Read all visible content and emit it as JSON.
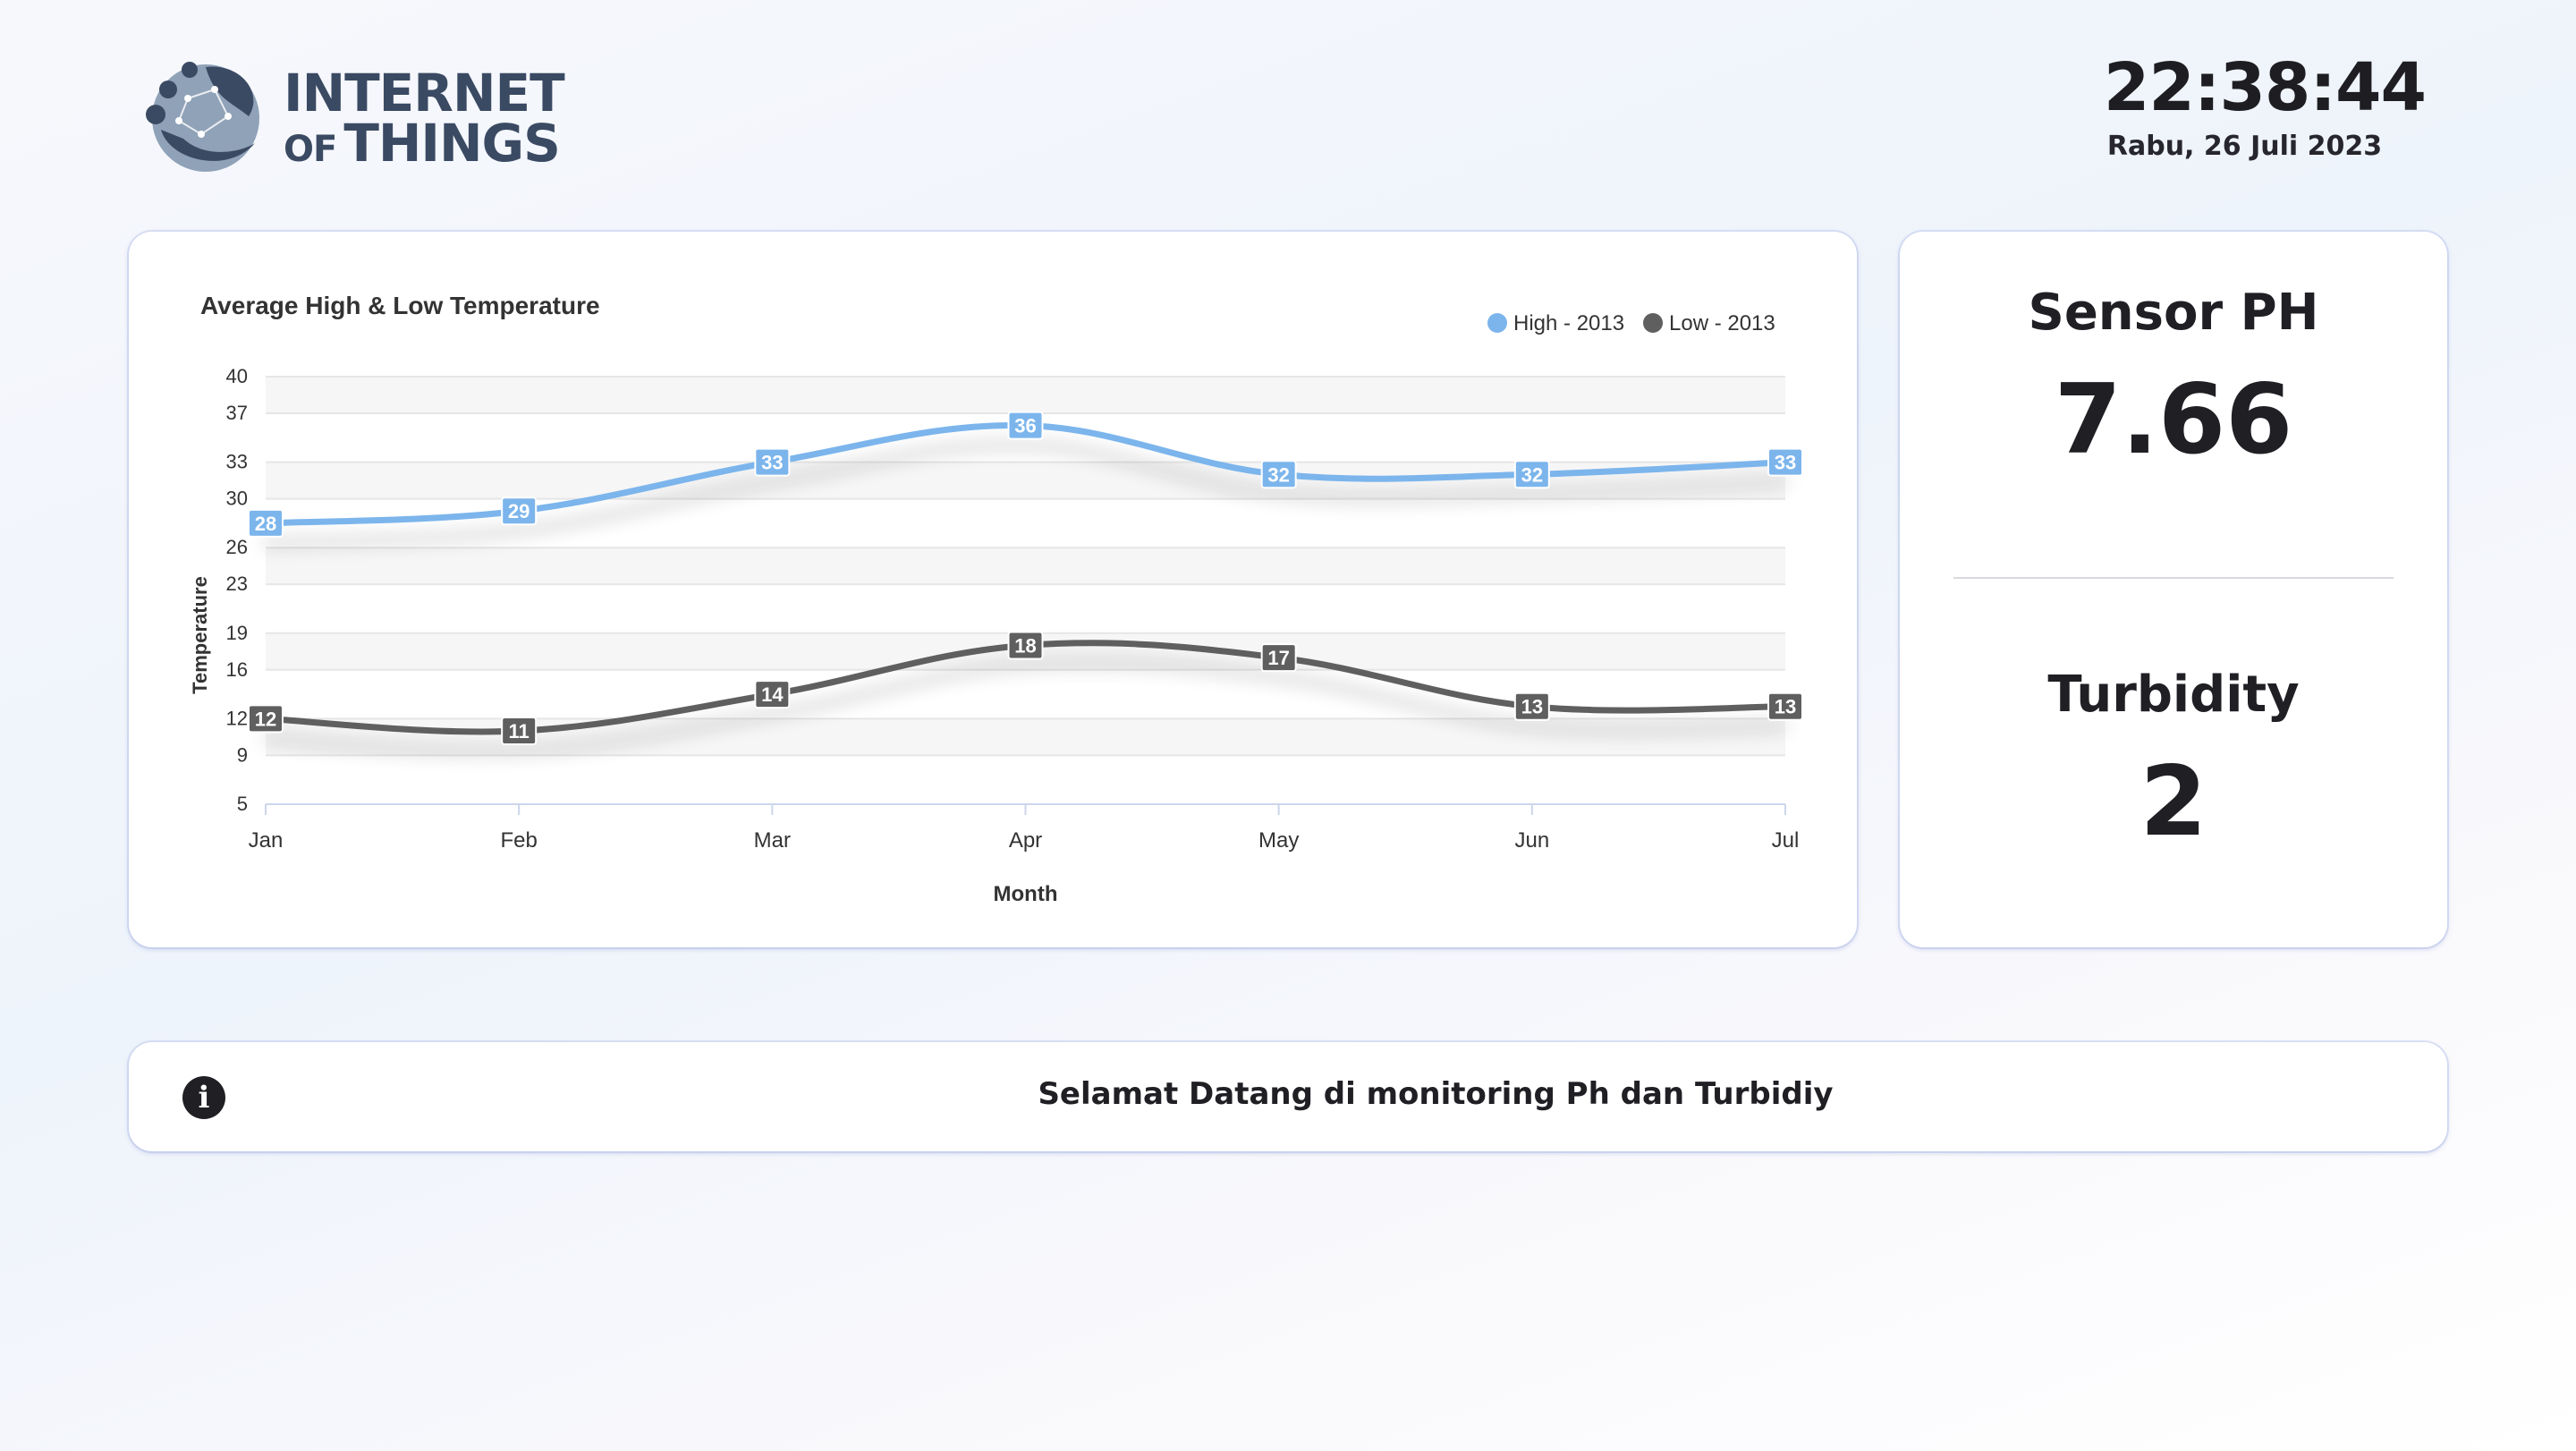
{
  "brand": {
    "logo_line1": "INTERNET",
    "logo_line2_prefix": "OF",
    "logo_line2_main": "THINGS",
    "logo_color": "#3b4a63"
  },
  "clock": {
    "time": "22:38:44",
    "date": "Rabu, 26 Juli 2023"
  },
  "chart_data": {
    "type": "line",
    "title": "Average High & Low Temperature",
    "xlabel": "Month",
    "ylabel": "Temperature",
    "categories": [
      "Jan",
      "Feb",
      "Mar",
      "Apr",
      "May",
      "Jun",
      "Jul"
    ],
    "yticks": [
      "5",
      "9",
      "12",
      "16",
      "19",
      "23",
      "26",
      "30",
      "33",
      "37",
      "40"
    ],
    "ylim": [
      5,
      40
    ],
    "grid": true,
    "legend_position": "top-right",
    "series": [
      {
        "name": "High - 2013",
        "color": "#7cb5ec",
        "values": [
          28,
          29,
          33,
          36,
          32,
          32,
          33
        ]
      },
      {
        "name": "Low - 2013",
        "color": "#5f5f5f",
        "values": [
          12,
          11,
          14,
          18,
          17,
          13,
          13
        ]
      }
    ]
  },
  "sensors": {
    "ph_title": "Sensor PH",
    "ph_value": "7.66",
    "turbidity_title": "Turbidity",
    "turbidity_value": "2"
  },
  "info": {
    "icon": "info-icon",
    "message": "Selamat Datang di monitoring Ph dan Turbidiy"
  }
}
